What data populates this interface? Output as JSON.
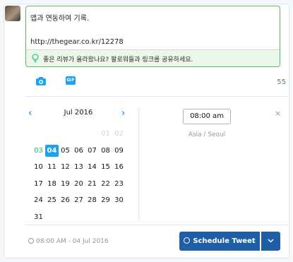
{
  "composer": {
    "text": "앱과 연동하여 기록.",
    "url": "http://thegear.co.kr/12278",
    "tip": "좋은 리뷰가 올라왔나요? 팔로워들과 링크를 공유하세요."
  },
  "toolbar": {
    "camera_icon": "camera-icon",
    "gif_label": "GIF",
    "char_count": "55"
  },
  "calendar": {
    "month_label": "Jul 2016",
    "prev_glyph": "‹",
    "next_glyph": "›",
    "days": [
      {
        "label": "",
        "state": "empty"
      },
      {
        "label": "",
        "state": "empty"
      },
      {
        "label": "",
        "state": "empty"
      },
      {
        "label": "",
        "state": "empty"
      },
      {
        "label": "",
        "state": "empty"
      },
      {
        "label": "01",
        "state": "muted"
      },
      {
        "label": "02",
        "state": "muted"
      },
      {
        "label": "03",
        "state": "today"
      },
      {
        "label": "04",
        "state": "selected"
      },
      {
        "label": "05",
        "state": "normal"
      },
      {
        "label": "06",
        "state": "normal"
      },
      {
        "label": "07",
        "state": "normal"
      },
      {
        "label": "08",
        "state": "normal"
      },
      {
        "label": "09",
        "state": "normal"
      },
      {
        "label": "10",
        "state": "normal"
      },
      {
        "label": "11",
        "state": "normal"
      },
      {
        "label": "12",
        "state": "normal"
      },
      {
        "label": "13",
        "state": "normal"
      },
      {
        "label": "14",
        "state": "normal"
      },
      {
        "label": "15",
        "state": "normal"
      },
      {
        "label": "16",
        "state": "normal"
      },
      {
        "label": "17",
        "state": "normal"
      },
      {
        "label": "18",
        "state": "normal"
      },
      {
        "label": "19",
        "state": "normal"
      },
      {
        "label": "20",
        "state": "normal"
      },
      {
        "label": "21",
        "state": "normal"
      },
      {
        "label": "22",
        "state": "normal"
      },
      {
        "label": "23",
        "state": "normal"
      },
      {
        "label": "24",
        "state": "normal"
      },
      {
        "label": "25",
        "state": "normal"
      },
      {
        "label": "26",
        "state": "normal"
      },
      {
        "label": "27",
        "state": "normal"
      },
      {
        "label": "28",
        "state": "normal"
      },
      {
        "label": "29",
        "state": "normal"
      },
      {
        "label": "30",
        "state": "normal"
      },
      {
        "label": "31",
        "state": "normal"
      }
    ]
  },
  "time": {
    "value": "08:00 am",
    "timezone": "Asia / Seoul",
    "close_glyph": "×"
  },
  "footer": {
    "scheduled_for": "08:00 AM - 04 Jul 2016",
    "button_label": "Schedule Tweet"
  },
  "colors": {
    "accent": "#1da1f2",
    "button": "#1f5fa8",
    "success": "#17bf63",
    "composer_border": "#5cb85c"
  }
}
